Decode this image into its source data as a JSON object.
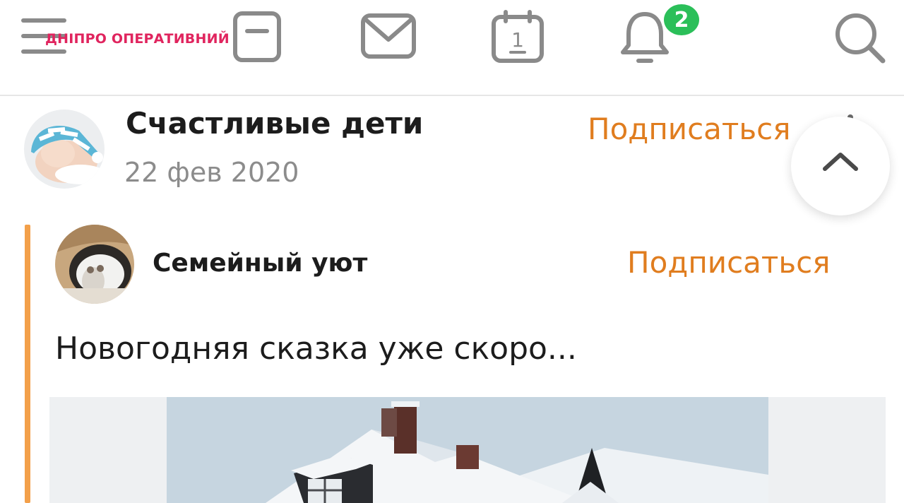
{
  "watermark": {
    "text": "ДНІПРО ОПЕРАТИВНИЙ"
  },
  "toolbar": {
    "notification_count": "2"
  },
  "post": {
    "group_name": "Счастливые дети",
    "date": "22 фев 2020",
    "subscribe_label": "Подписаться"
  },
  "repost": {
    "group_name": "Семейный уют",
    "subscribe_label": "Подписаться",
    "text": "Новогодняя сказка уже скоро..."
  },
  "colors": {
    "accent_orange": "#e07d1f",
    "repost_bar": "#f3a04a",
    "badge_green": "#2bbf59",
    "watermark_pink": "#e0245e"
  },
  "icons": [
    "menu-icon",
    "notes-icon",
    "mail-icon",
    "calendar-icon",
    "bell-icon",
    "search-icon",
    "chevron-up-icon"
  ]
}
